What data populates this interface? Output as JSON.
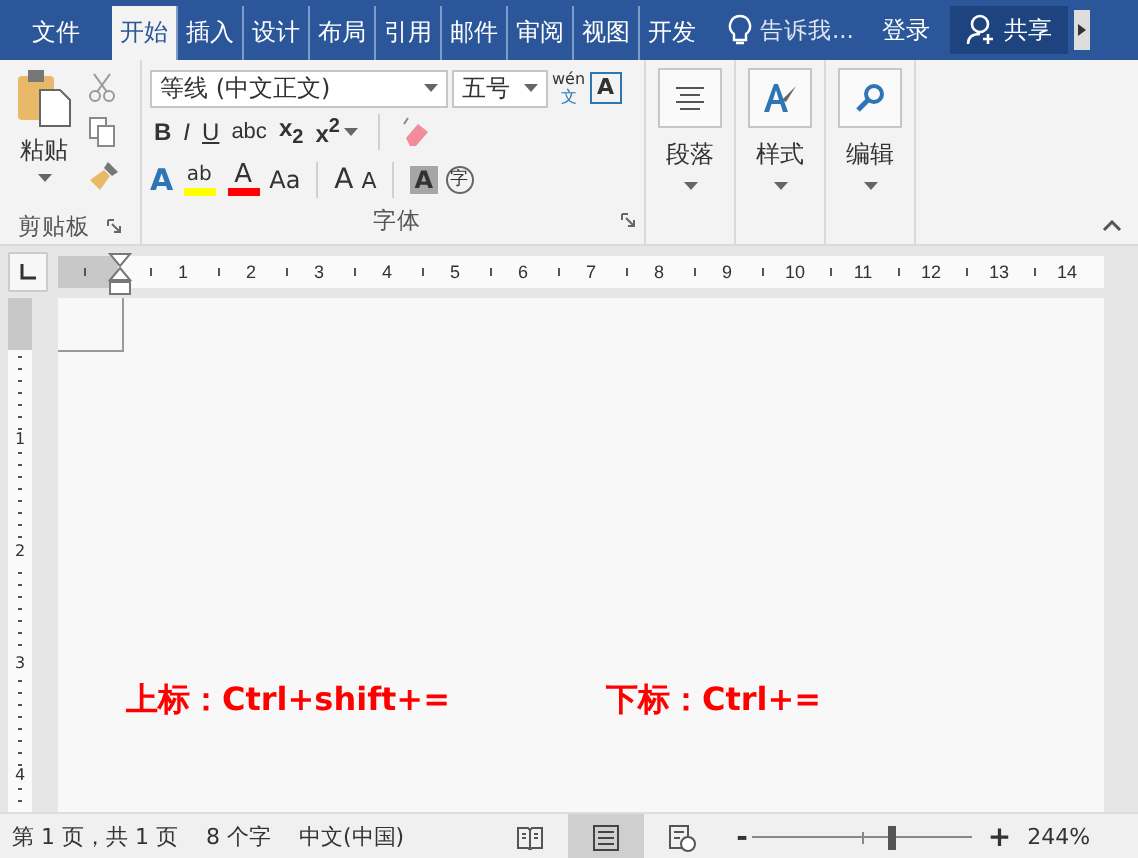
{
  "tabs": [
    {
      "label": "文件",
      "selected": false
    },
    {
      "label": "开始",
      "selected": true
    },
    {
      "label": "插入",
      "selected": false
    },
    {
      "label": "设计",
      "selected": false
    },
    {
      "label": "布局",
      "selected": false
    },
    {
      "label": "引用",
      "selected": false
    },
    {
      "label": "邮件",
      "selected": false
    },
    {
      "label": "审阅",
      "selected": false
    },
    {
      "label": "视图",
      "selected": false
    },
    {
      "label": "开发",
      "selected": false
    }
  ],
  "tell_me": "告诉我...",
  "login": "登录",
  "share": "共享",
  "clipboard": {
    "paste": "粘贴",
    "label": "剪贴板"
  },
  "font": {
    "name": "等线 (中文正文)",
    "size": "五号",
    "phonetic_top": "wén",
    "phonetic_bottom": "文",
    "char_border": "A",
    "format_buttons": [
      "B",
      "I",
      "U",
      "abc",
      "x$_{2}$",
      "x$^{2}$"
    ],
    "effects": "A",
    "highlight": {
      "label": "ab",
      "color": "#ffff00"
    },
    "font_color": {
      "label": "A",
      "color": "#ff0000"
    },
    "change_case": "Aa",
    "grow": "A",
    "shrink": "A",
    "shading": "A",
    "enclose": "字",
    "label": "字体"
  },
  "big_groups": [
    {
      "label": "段落",
      "kind": "paragraph"
    },
    {
      "label": "样式",
      "kind": "styles"
    },
    {
      "label": "编辑",
      "kind": "editing"
    }
  ],
  "ruler": [
    "1",
    "2",
    "3",
    "4",
    "5",
    "6",
    "7",
    "8",
    "9",
    "10",
    "11",
    "12",
    "13",
    "14"
  ],
  "vruler": [
    "1",
    "2",
    "3",
    "4"
  ],
  "document": {
    "superscript": "上标：Ctrl+shift+=",
    "subscript": "下标：Ctrl+="
  },
  "status": {
    "page": "第 1 页，共 1 页",
    "words": "8 个字",
    "language": "中文(中国)",
    "views": [
      {
        "kind": "read",
        "selected": false
      },
      {
        "kind": "print",
        "selected": true
      },
      {
        "kind": "web",
        "selected": false
      }
    ],
    "zoom_minus": "-",
    "zoom_plus": "+",
    "zoom_slider": {
      "level": 0.64
    },
    "zoom": "244%"
  }
}
